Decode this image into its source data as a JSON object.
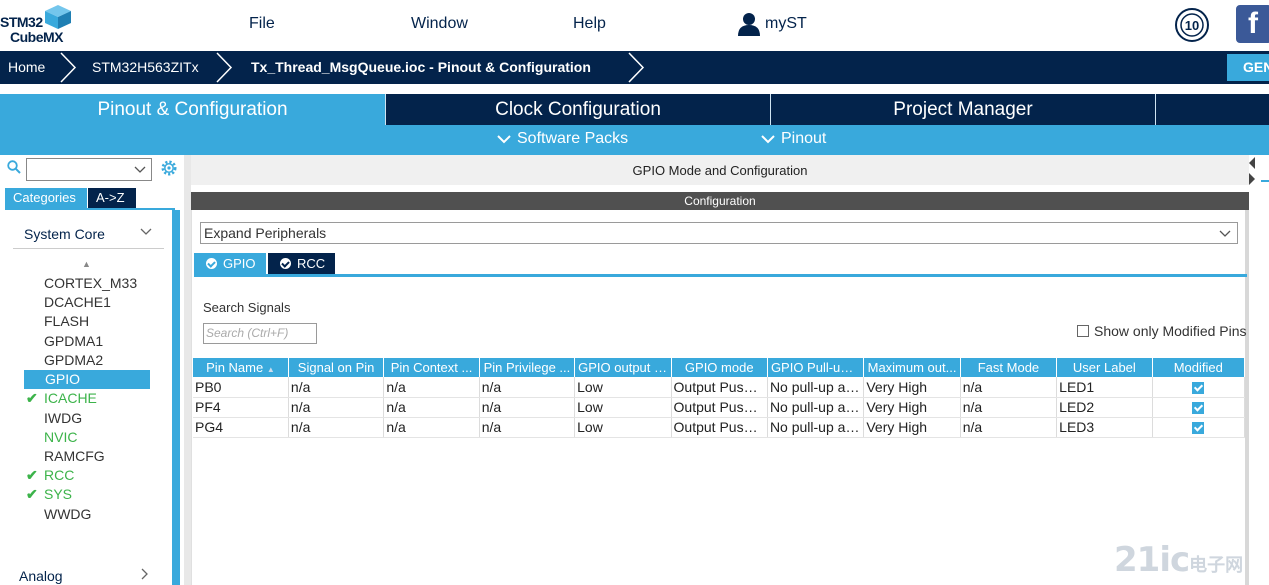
{
  "brand": {
    "line1": "STM32",
    "line2": "CubeMX"
  },
  "menu": {
    "file": "File",
    "window": "Window",
    "help": "Help",
    "user": "myST"
  },
  "badge": {
    "text": "10"
  },
  "social": {
    "facebook": "f"
  },
  "breadcrumb": {
    "home": "Home",
    "device": "STM32H563ZITx",
    "project": "Tx_Thread_MsgQueue.ioc - Pinout & Configuration",
    "generate": "GEN"
  },
  "main_tabs": {
    "pinout": "Pinout & Configuration",
    "clock": "Clock Configuration",
    "project": "Project Manager"
  },
  "sub_tabs": {
    "software_packs": "Software Packs",
    "pinout": "Pinout"
  },
  "left": {
    "tab_categories": "Categories",
    "tab_az": "A->Z",
    "section_system_core": "System Core",
    "items": [
      "CORTEX_M33",
      "DCACHE1",
      "FLASH",
      "GPDMA1",
      "GPDMA2",
      "GPIO",
      "ICACHE",
      "IWDG",
      "NVIC",
      "RAMCFG",
      "RCC",
      "SYS",
      "WWDG"
    ],
    "section_analog": "Analog"
  },
  "panel": {
    "header": "GPIO Mode and Configuration",
    "config": "Configuration",
    "expand": "Expand Peripherals",
    "tab_gpio": "GPIO",
    "tab_rcc": "RCC",
    "search_label": "Search Signals",
    "search_placeholder": "Search (Ctrl+F)",
    "modified_only": "Show only Modified Pins"
  },
  "table": {
    "columns": [
      "Pin Name",
      "Signal on Pin",
      "Pin Context ...",
      "Pin Privilege ...",
      "GPIO output l...",
      "GPIO mode",
      "GPIO Pull-up/...",
      "Maximum out...",
      "Fast Mode",
      "User Label",
      "Modified"
    ],
    "rows": [
      [
        "PB0",
        "n/a",
        "n/a",
        "n/a",
        "Low",
        "Output Push ...",
        "No pull-up an...",
        "Very High",
        "n/a",
        "LED1",
        "checked"
      ],
      [
        "PF4",
        "n/a",
        "n/a",
        "n/a",
        "Low",
        "Output Push ...",
        "No pull-up an...",
        "Very High",
        "n/a",
        "LED2",
        "checked"
      ],
      [
        "PG4",
        "n/a",
        "n/a",
        "n/a",
        "Low",
        "Output Push ...",
        "No pull-up an...",
        "Very High",
        "n/a",
        "LED3",
        "checked"
      ]
    ]
  },
  "watermark": {
    "main": "21ic",
    "sub": "电子网"
  },
  "colors": {
    "navy": "#03234b",
    "accent": "#39a9dc",
    "green": "#3cb34a"
  }
}
